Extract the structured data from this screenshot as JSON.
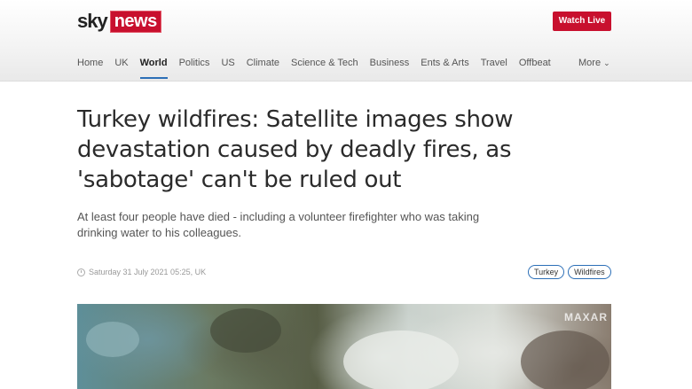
{
  "header": {
    "logo_sky": "sky",
    "logo_news": "news",
    "watch_live": "Watch Live",
    "nav": [
      "Home",
      "UK",
      "World",
      "Politics",
      "US",
      "Climate",
      "Science & Tech",
      "Business",
      "Ents & Arts",
      "Travel",
      "Offbeat"
    ],
    "active_nav": "World",
    "more_label": "More"
  },
  "article": {
    "headline": "Turkey wildfires: Satellite images show devastation caused by deadly fires, as 'sabotage' can't be ruled out",
    "standfirst": "At least four people have died - including a volunteer firefighter who was taking drinking water to his colleagues.",
    "timestamp": "Saturday 31 July 2021 05:25, UK",
    "tags": [
      "Turkey",
      "Wildfires"
    ],
    "image_watermark": "MAXAR"
  },
  "colors": {
    "brand_red": "#c8102e",
    "active_underline": "#2c6fb7",
    "tag_border": "#2c6fb7"
  }
}
